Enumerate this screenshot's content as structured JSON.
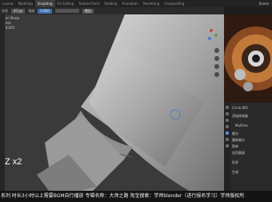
{
  "menubar": {
    "tabs": [
      "Layout",
      "Modeling",
      "Sculpting",
      "UV Editing",
      "Texture Paint",
      "Shading",
      "Animation",
      "Rendering",
      "Compositing"
    ],
    "active_tab": "Sculpting",
    "scene": "Scene"
  },
  "header": {
    "radius_label": "半径",
    "radius_value": "47 px",
    "strength_label": "强度",
    "strength_value": "0.600",
    "direction": "增加"
  },
  "viewport": {
    "overlay_lines": [
      "er Sharp",
      "ero",
      "8,641"
    ],
    "key_hint": "Z x2"
  },
  "properties": {
    "object_name": "Circle.001",
    "section1": "添加修改器",
    "modifier": "Multires",
    "rows": [
      "细分",
      "重新细分",
      "简单",
      "应用基面",
      "形状",
      "生成"
    ]
  },
  "subtitle": "系列 时长3小时以上需要BGM自行播放  专辑名称：大师之路  淘宝搜索：学师blender（进行报名学习）学师版权所"
}
